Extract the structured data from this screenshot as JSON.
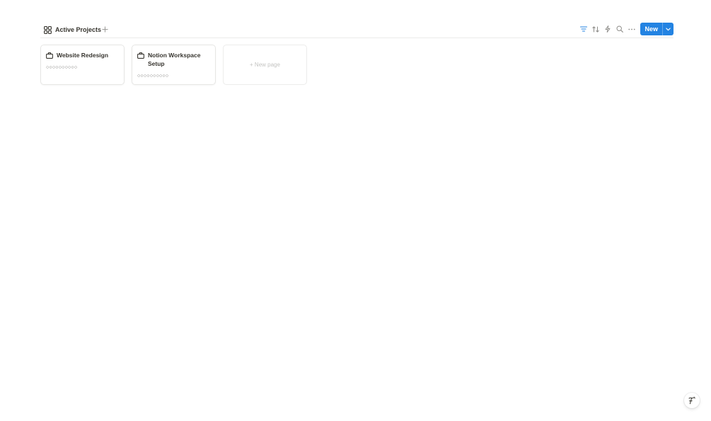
{
  "view": {
    "tab_label": "Active Projects",
    "tab_icon": "gallery-grid-icon",
    "add_view_icon": "plus-icon"
  },
  "toolbar": {
    "filter_icon": "filter-icon",
    "sort_icon": "sort-icon",
    "automation_icon": "lightning-icon",
    "search_icon": "search-icon",
    "more_icon": "more-horizontal-icon",
    "new_label": "New",
    "new_caret_icon": "chevron-down-icon",
    "accent_color": "#2383e2"
  },
  "cards": [
    {
      "title": "Website Redesign",
      "icon": "briefcase-icon",
      "property": "○○○○○○○○○○"
    },
    {
      "title": "Notion Workspace Setup",
      "icon": "briefcase-icon",
      "property": "○○○○○○○○○○"
    }
  ],
  "new_page": {
    "label": "+ New page"
  },
  "help": {
    "icon": "feedback-icon"
  }
}
